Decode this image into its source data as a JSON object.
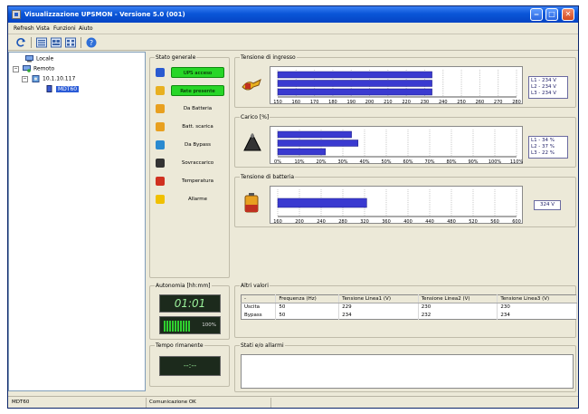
{
  "window": {
    "title": "Visualizzazione UPSMON - Versione 5.0 (001)"
  },
  "menu": [
    {
      "label": "Refresh"
    },
    {
      "label": "Vista"
    },
    {
      "label": "Funzioni"
    },
    {
      "label": "Aiuto"
    }
  ],
  "toolbar": [
    {
      "icon": "refresh-icon"
    },
    {
      "icon": "view-list-icon"
    },
    {
      "icon": "view-details-icon"
    },
    {
      "icon": "view-grid-icon"
    },
    {
      "icon": "help-icon"
    }
  ],
  "tree": {
    "local": "Locale",
    "remote": "Remoto",
    "host": "10.1.10.117",
    "device": "MDT60"
  },
  "stato_generale": {
    "title": "Stato generale",
    "items": [
      {
        "label": "UPS acceso",
        "active": true,
        "icon": "ups-icon"
      },
      {
        "label": "Rete presente",
        "active": true,
        "icon": "power-line-icon"
      },
      {
        "label": "Da Batteria",
        "active": false,
        "icon": "battery-icon"
      },
      {
        "label": "Batt. scarica",
        "active": false,
        "icon": "battery-low-icon"
      },
      {
        "label": "Da Bypass",
        "active": false,
        "icon": "bypass-icon"
      },
      {
        "label": "Sovraccarico",
        "active": false,
        "icon": "overload-icon"
      },
      {
        "label": "Temperatura",
        "active": false,
        "icon": "thermometer-icon"
      },
      {
        "label": "Allarme",
        "active": false,
        "icon": "warning-icon"
      }
    ]
  },
  "autonomia": {
    "title": "Autonomia [hh:mm]",
    "time": "01:01",
    "battery_percent": "100%",
    "battery_level": 100
  },
  "tempo_rimanente": {
    "title": "Tempo rimanente",
    "value": "--:--"
  },
  "chart_data": [
    {
      "type": "bar",
      "title": "Tensione di ingresso",
      "orientation": "horizontal",
      "series": [
        {
          "name": "L1",
          "value": 234
        },
        {
          "name": "L2",
          "value": 234
        },
        {
          "name": "L3",
          "value": 234
        }
      ],
      "xlim": [
        150,
        280
      ],
      "ticks": [
        "150",
        "160",
        "170",
        "180",
        "190",
        "200",
        "210",
        "220",
        "230",
        "240",
        "250",
        "260",
        "270",
        "280"
      ],
      "legend": [
        "L1 - 234 V",
        "L2 - 234 V",
        "L3 - 234 V"
      ],
      "grid": true,
      "legend_position": "right"
    },
    {
      "type": "bar",
      "title": "Carico [%]",
      "orientation": "horizontal",
      "series": [
        {
          "name": "L1",
          "value": 34
        },
        {
          "name": "L2",
          "value": 37
        },
        {
          "name": "L3",
          "value": 22
        }
      ],
      "xlim": [
        0,
        110
      ],
      "ticks": [
        "0%",
        "10%",
        "20%",
        "30%",
        "40%",
        "50%",
        "60%",
        "70%",
        "80%",
        "90%",
        "100%",
        "110%"
      ],
      "legend": [
        "L1 - 34 %",
        "L2 - 37 %",
        "L3 - 22 %"
      ],
      "grid": true,
      "legend_position": "right"
    },
    {
      "type": "bar",
      "title": "Tensione di batteria",
      "orientation": "horizontal",
      "series": [
        {
          "name": "Batteria",
          "value": 324
        }
      ],
      "xlim": [
        160,
        600
      ],
      "ticks": [
        "160",
        "200",
        "240",
        "280",
        "320",
        "360",
        "400",
        "440",
        "480",
        "520",
        "560",
        "600"
      ],
      "legend": [
        "324 V"
      ],
      "grid": true,
      "legend_position": "right"
    }
  ],
  "altri_valori": {
    "title": "Altri valori",
    "columns": [
      "-",
      "Frequenza (Hz)",
      "Tensione Linea1 (V)",
      "Tensione Linea2 (V)",
      "Tensione Linea3 (V)"
    ],
    "rows": [
      [
        "Uscita",
        "50",
        "229",
        "230",
        "230"
      ],
      [
        "Bypass",
        "50",
        "234",
        "232",
        "234"
      ]
    ]
  },
  "stati_allarmi": {
    "title": "Stati e/o allarmi"
  },
  "statusbar": {
    "left": "MDT60",
    "message": "Comunicazione OK"
  },
  "colors": {
    "accent": "#0a56d8",
    "bar": "#3a3ad0",
    "active": "#27d627",
    "lcd_text": "#9cf29c"
  }
}
